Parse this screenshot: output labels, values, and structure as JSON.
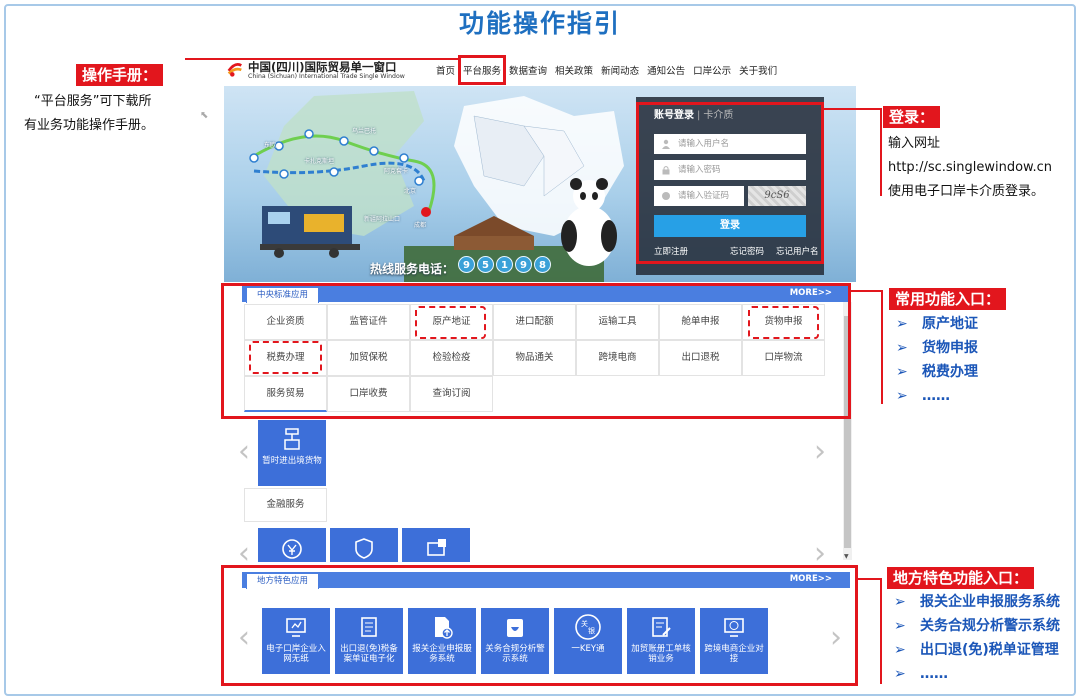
{
  "page": {
    "title": "功能操作指引"
  },
  "site": {
    "logo_cn": "中国(四川)国际贸易单一窗口",
    "logo_en": "China (Sichuan) International Trade Single Window",
    "nav": [
      "首页",
      "平台服务",
      "数据查询",
      "相关政策",
      "新闻动态",
      "通知公告",
      "口岸公示",
      "关于我们"
    ]
  },
  "banner": {
    "hotline_label": "热线服务电话：",
    "hotline_digits": [
      "9",
      "5",
      "1",
      "9",
      "8"
    ],
    "route_labels": [
      "新疆阿拉山口",
      "成都",
      "北京",
      "乌兰巴托",
      "阿克套卡",
      "东欧",
      "卡扎克斯坦"
    ]
  },
  "login": {
    "tab_active": "账号登录",
    "tab_other": "卡介质",
    "username_placeholder": "请输入用户名",
    "password_placeholder": "请输入密码",
    "captcha_placeholder": "请输入验证码",
    "captcha_text": "9⁠cS6",
    "submit": "登录",
    "register": "立即注册",
    "forgot_password": "忘记密码",
    "forgot_username": "忘记用户名"
  },
  "central": {
    "tab": "中央标准应用",
    "more": "MORE>>",
    "row1": [
      "企业资质",
      "监管证件",
      "原产地证",
      "进口配额",
      "运输工具",
      "舱单申报",
      "货物申报"
    ],
    "row2": [
      "税费办理",
      "加贸保税",
      "检验检疫",
      "物品通关",
      "跨境电商",
      "出口退税",
      "口岸物流"
    ],
    "row3": [
      "服务贸易",
      "口岸收费",
      "查询订阅"
    ],
    "tile_temp": "暂时进出境货物",
    "finance": "金融服务"
  },
  "local": {
    "tab": "地方特色应用",
    "more": "MORE>>",
    "tiles": [
      "电子口岸企业入网无纸",
      "出口退(免)税备案单证电子化",
      "报关企业申报服务系统",
      "关务合规分析警示系统",
      "一KEY通",
      "加贸账册工单核销业务",
      "跨境电商企业对接"
    ]
  },
  "annotations": {
    "manual_label": "操作手册：",
    "manual_note_1": "“平台服务”可下载所",
    "manual_note_2": "有业务功能操作手册。",
    "login_label": "登录：",
    "login_note_1": "输入网址",
    "login_url": "http://sc.singlewindow.cn",
    "login_note_2": "使用电子口岸卡介质登录。",
    "common_label": "常用功能入口：",
    "common_items": [
      "原产地证",
      "货物申报",
      "税费办理",
      "……"
    ],
    "local_label": "地方特色功能入口：",
    "local_items": [
      "报关企业申报服务系统",
      "关务合规分析警示系统",
      "出口退(免)税单证管理",
      "……"
    ]
  },
  "colors": {
    "accent": "#e2161d",
    "title": "#1e6fc0",
    "tile": "#3d6fd9",
    "link": "#1b56b8"
  }
}
